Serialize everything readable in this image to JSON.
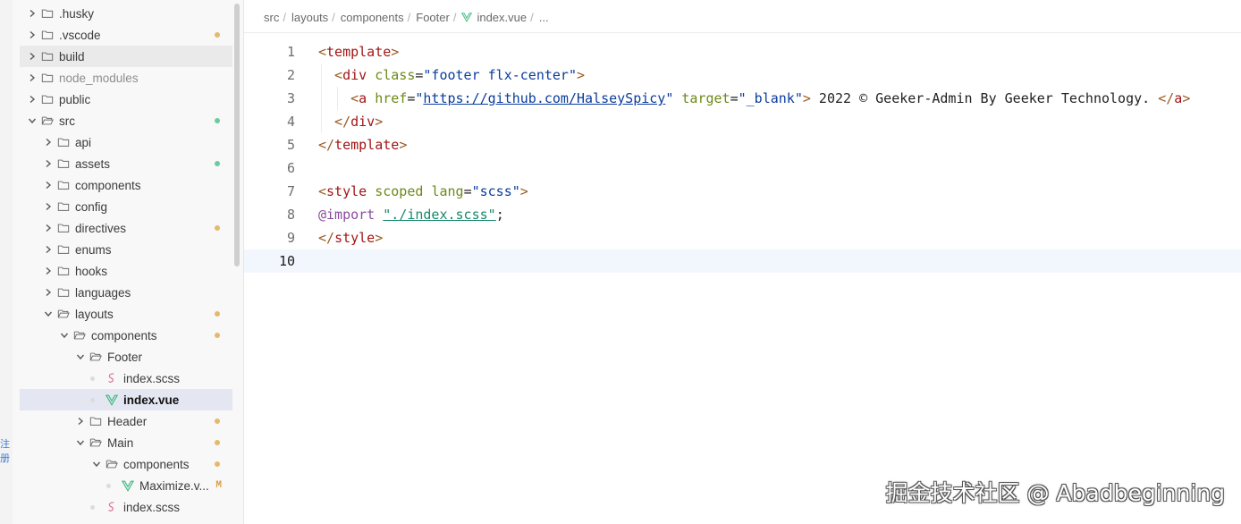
{
  "explorer": {
    "items": [
      {
        "label": ".husky",
        "type": "folder",
        "depth": 0,
        "open": false
      },
      {
        "label": ".vscode",
        "type": "folder",
        "depth": 0,
        "open": false,
        "status": "modified"
      },
      {
        "label": "build",
        "type": "folder",
        "depth": 0,
        "open": false,
        "hover": true
      },
      {
        "label": "node_modules",
        "type": "folder",
        "depth": 0,
        "open": false,
        "dimmed": true
      },
      {
        "label": "public",
        "type": "folder",
        "depth": 0,
        "open": false
      },
      {
        "label": "src",
        "type": "folder",
        "depth": 0,
        "open": true,
        "status": "added"
      },
      {
        "label": "api",
        "type": "folder",
        "depth": 1,
        "open": false
      },
      {
        "label": "assets",
        "type": "folder",
        "depth": 1,
        "open": false,
        "status": "added"
      },
      {
        "label": "components",
        "type": "folder",
        "depth": 1,
        "open": false
      },
      {
        "label": "config",
        "type": "folder",
        "depth": 1,
        "open": false
      },
      {
        "label": "directives",
        "type": "folder",
        "depth": 1,
        "open": false,
        "status": "modified"
      },
      {
        "label": "enums",
        "type": "folder",
        "depth": 1,
        "open": false
      },
      {
        "label": "hooks",
        "type": "folder",
        "depth": 1,
        "open": false
      },
      {
        "label": "languages",
        "type": "folder",
        "depth": 1,
        "open": false
      },
      {
        "label": "layouts",
        "type": "folder",
        "depth": 1,
        "open": true,
        "status": "modified"
      },
      {
        "label": "components",
        "type": "folder",
        "depth": 2,
        "open": true,
        "status": "modified"
      },
      {
        "label": "Footer",
        "type": "folder",
        "depth": 3,
        "open": true
      },
      {
        "label": "index.scss",
        "type": "scss",
        "depth": 4
      },
      {
        "label": "index.vue",
        "type": "vue",
        "depth": 4,
        "selected": true
      },
      {
        "label": "Header",
        "type": "folder",
        "depth": 3,
        "open": false,
        "status": "modified"
      },
      {
        "label": "Main",
        "type": "folder",
        "depth": 3,
        "open": true,
        "status": "modified"
      },
      {
        "label": "components",
        "type": "folder",
        "depth": 4,
        "open": true,
        "status": "modified"
      },
      {
        "label": "Maximize.v...",
        "type": "vue",
        "depth": 5,
        "badge": "M"
      },
      {
        "label": "index.scss",
        "type": "scss",
        "depth": 4
      }
    ]
  },
  "breadcrumb": {
    "parts": [
      "src",
      "layouts",
      "components",
      "Footer",
      "index.vue",
      "..."
    ]
  },
  "editor": {
    "current_line": 10,
    "lines": [
      {
        "n": "1",
        "tokens": [
          {
            "c": "b",
            "t": "<"
          },
          {
            "c": "t",
            "t": "template"
          },
          {
            "c": "b",
            "t": ">"
          }
        ]
      },
      {
        "n": "2",
        "indent": 1,
        "tokens": [
          {
            "c": "b",
            "t": "<"
          },
          {
            "c": "t",
            "t": "div"
          },
          {
            "c": "p",
            "t": " "
          },
          {
            "c": "a",
            "t": "class"
          },
          {
            "c": "p",
            "t": "="
          },
          {
            "c": "s",
            "t": "\"footer flx-center\""
          },
          {
            "c": "b",
            "t": ">"
          }
        ]
      },
      {
        "n": "3",
        "indent": 2,
        "tokens": [
          {
            "c": "b",
            "t": "<"
          },
          {
            "c": "t",
            "t": "a"
          },
          {
            "c": "p",
            "t": " "
          },
          {
            "c": "a",
            "t": "href"
          },
          {
            "c": "p",
            "t": "="
          },
          {
            "c": "s",
            "t": "\""
          },
          {
            "c": "u",
            "t": "https://github.com/HalseySpicy"
          },
          {
            "c": "s",
            "t": "\""
          },
          {
            "c": "p",
            "t": " "
          },
          {
            "c": "a",
            "t": "target"
          },
          {
            "c": "p",
            "t": "="
          },
          {
            "c": "s",
            "t": "\"_blank\""
          },
          {
            "c": "b",
            "t": ">"
          },
          {
            "c": "p",
            "t": " 2022 © Geeker-Admin By Geeker Technology. "
          },
          {
            "c": "b",
            "t": "</"
          },
          {
            "c": "t",
            "t": "a"
          },
          {
            "c": "b",
            "t": ">"
          }
        ]
      },
      {
        "n": "4",
        "indent": 1,
        "tokens": [
          {
            "c": "b",
            "t": "</"
          },
          {
            "c": "t",
            "t": "div"
          },
          {
            "c": "b",
            "t": ">"
          }
        ]
      },
      {
        "n": "5",
        "tokens": [
          {
            "c": "b",
            "t": "</"
          },
          {
            "c": "t",
            "t": "template"
          },
          {
            "c": "b",
            "t": ">"
          }
        ]
      },
      {
        "n": "6",
        "tokens": []
      },
      {
        "n": "7",
        "tokens": [
          {
            "c": "b",
            "t": "<"
          },
          {
            "c": "t",
            "t": "style"
          },
          {
            "c": "p",
            "t": " "
          },
          {
            "c": "a",
            "t": "scoped"
          },
          {
            "c": "p",
            "t": " "
          },
          {
            "c": "a",
            "t": "lang"
          },
          {
            "c": "p",
            "t": "="
          },
          {
            "c": "s",
            "t": "\"scss\""
          },
          {
            "c": "b",
            "t": ">"
          }
        ]
      },
      {
        "n": "8",
        "tokens": [
          {
            "c": "at",
            "t": "@import"
          },
          {
            "c": "p",
            "t": " "
          },
          {
            "c": "st",
            "t": "\"./index.scss\""
          },
          {
            "c": "p",
            "t": ";"
          }
        ]
      },
      {
        "n": "9",
        "tokens": [
          {
            "c": "b",
            "t": "</"
          },
          {
            "c": "t",
            "t": "style"
          },
          {
            "c": "b",
            "t": ">"
          }
        ]
      },
      {
        "n": "10",
        "tokens": []
      }
    ]
  },
  "edge_text": "注册",
  "watermark": "掘金技术社区 @ Abadbeginning",
  "colors": {
    "modified": "#e5b96a",
    "added": "#6ccb9e",
    "vue": "#41b883",
    "scss": "#e06c8a",
    "selected_row": "#e4e6f1"
  }
}
